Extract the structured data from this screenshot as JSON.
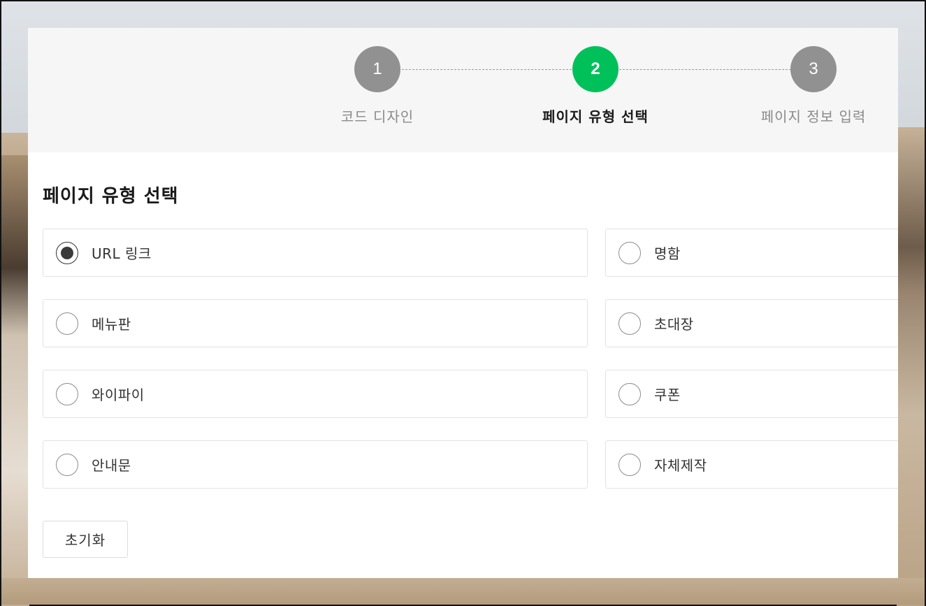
{
  "stepper": {
    "steps": [
      {
        "number": "1",
        "label": "코드 디자인",
        "active": false
      },
      {
        "number": "2",
        "label": "페이지 유형 선택",
        "active": true
      },
      {
        "number": "3",
        "label": "페이지 정보 입력",
        "active": false
      }
    ],
    "active_color": "#00c159",
    "inactive_color": "#919191"
  },
  "section": {
    "title": "페이지 유형 선택"
  },
  "page_types": {
    "selected": "URL 링크",
    "options": [
      {
        "label": "URL 링크",
        "checked": true
      },
      {
        "label": "명함",
        "checked": false
      },
      {
        "label": "메뉴판",
        "checked": false
      },
      {
        "label": "초대장",
        "checked": false
      },
      {
        "label": "와이파이",
        "checked": false
      },
      {
        "label": "쿠폰",
        "checked": false
      },
      {
        "label": "안내문",
        "checked": false
      },
      {
        "label": "자체제작",
        "checked": false
      }
    ]
  },
  "actions": {
    "reset_label": "초기화"
  }
}
